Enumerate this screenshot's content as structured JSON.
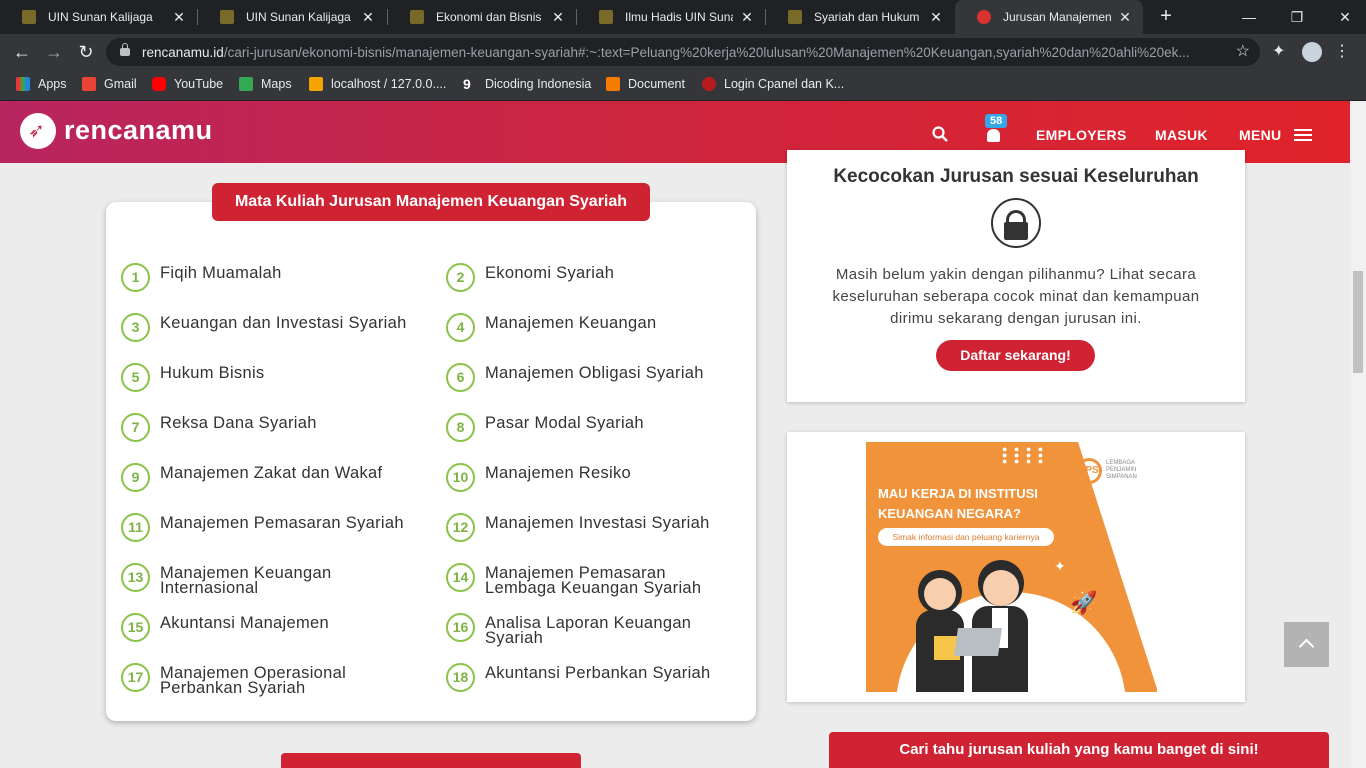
{
  "browser": {
    "tabs": [
      {
        "title": "UIN Sunan Kalijaga"
      },
      {
        "title": "UIN Sunan Kalijaga"
      },
      {
        "title": "Ekonomi dan Bisnis Isla"
      },
      {
        "title": "Ilmu Hadis UIN Sunan K"
      },
      {
        "title": "Syariah dan Hukum UIN"
      },
      {
        "title": "Jurusan Manajemen Ke"
      }
    ],
    "url_domain": "rencanamu.id",
    "url_path": "/cari-jurusan/ekonomi-bisnis/manajemen-keuangan-syariah#:~:text=Peluang%20kerja%20lulusan%20Manajemen%20Keuangan,syariah%20dan%20ahli%20ek...",
    "bookmarks": [
      {
        "label": "Apps",
        "color": "#e53935"
      },
      {
        "label": "Gmail",
        "color": "#ea4335"
      },
      {
        "label": "YouTube",
        "color": "#ff0000"
      },
      {
        "label": "Maps",
        "color": "#34a853"
      },
      {
        "label": "localhost / 127.0.0....",
        "color": "#f4a300"
      },
      {
        "label": "Dicoding Indonesia",
        "color": "#ffffff"
      },
      {
        "label": "Document",
        "color": "#f57c00"
      },
      {
        "label": "Login Cpanel dan K...",
        "color": "#b71c1c"
      }
    ]
  },
  "site": {
    "logo": "rencanamu",
    "notif_count": "58",
    "nav": {
      "employers": "EMPLOYERS",
      "masuk": "MASUK",
      "menu": "MENU"
    },
    "brand_color": "#cf2333"
  },
  "courses": {
    "title": "Mata Kuliah Jurusan Manajemen Keuangan Syariah",
    "items": [
      {
        "n": "1",
        "name": "Fiqih Muamalah"
      },
      {
        "n": "2",
        "name": "Ekonomi Syariah"
      },
      {
        "n": "3",
        "name": "Keuangan dan Investasi Syariah"
      },
      {
        "n": "4",
        "name": "Manajemen Keuangan"
      },
      {
        "n": "5",
        "name": "Hukum Bisnis"
      },
      {
        "n": "6",
        "name": "Manajemen Obligasi Syariah"
      },
      {
        "n": "7",
        "name": "Reksa Dana Syariah"
      },
      {
        "n": "8",
        "name": "Pasar Modal Syariah"
      },
      {
        "n": "9",
        "name": "Manajemen Zakat dan Wakaf"
      },
      {
        "n": "10",
        "name": "Manajemen Resiko"
      },
      {
        "n": "11",
        "name": "Manajemen Pemasaran Syariah"
      },
      {
        "n": "12",
        "name": "Manajemen Investasi Syariah"
      },
      {
        "n": "13",
        "name": "Manajemen Keuangan Internasional"
      },
      {
        "n": "14",
        "name": "Manajemen Pemasaran Lembaga Keuangan Syariah"
      },
      {
        "n": "15",
        "name": "Akuntansi Manajemen"
      },
      {
        "n": "16",
        "name": "Analisa Laporan Keuangan Syariah"
      },
      {
        "n": "17",
        "name": "Manajemen Operasional Perbankan Syariah"
      },
      {
        "n": "18",
        "name": "Akuntansi Perbankan Syariah"
      }
    ]
  },
  "match": {
    "title": "Kecocokan Jurusan sesuai Keseluruhan",
    "text": "Masih belum yakin dengan pilihanmu? Lihat secara keseluruhan seberapa cocok minat dan kemampuan dirimu sekarang dengan jurusan ini.",
    "button": "Daftar sekarang!"
  },
  "ad": {
    "title_line1": "MAU KERJA DI INSTITUSI",
    "title_line2": "KEUANGAN NEGARA?",
    "pill": "Simak informasi dan peluang kariernya",
    "logo": "LPS",
    "logo_text_1": "LEMBAGA",
    "logo_text_2": "PENJAMIN",
    "logo_text_3": "SIMPANAN"
  },
  "bottom_banner": "Cari tahu jurusan kuliah yang kamu banget di sini!"
}
